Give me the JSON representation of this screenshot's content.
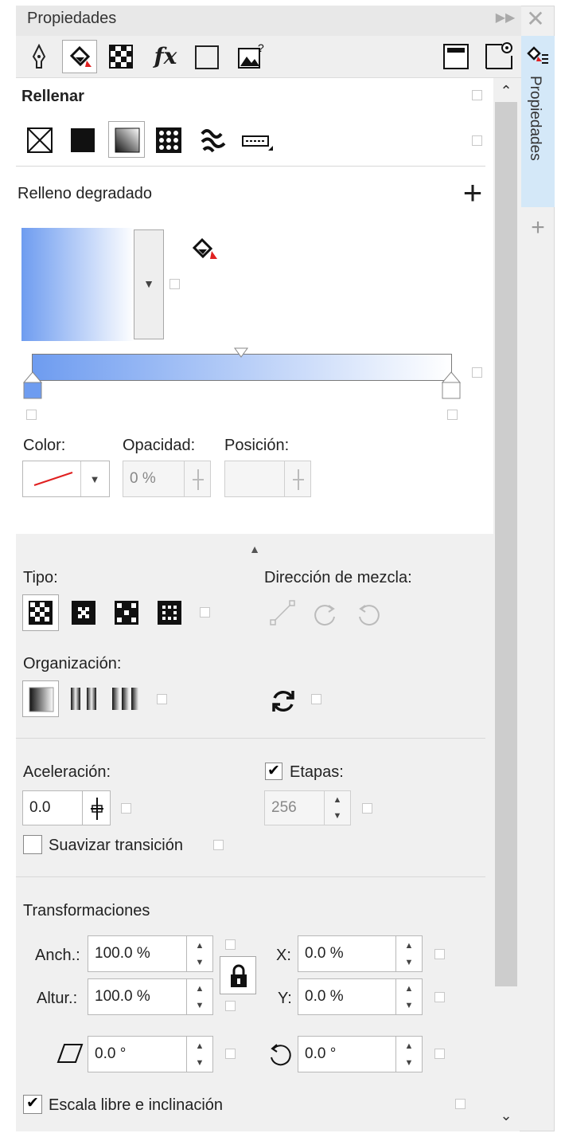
{
  "window": {
    "title": "Propiedades",
    "side_tab_label": "Propiedades"
  },
  "fill": {
    "heading": "Rellenar",
    "section_label": "Relleno degradado",
    "gradient_colors": [
      "#6e9cf0",
      "#ffffff"
    ]
  },
  "node": {
    "color_label": "Color:",
    "opacity_label": "Opacidad:",
    "opacity_value": "0 %",
    "position_label": "Posición:",
    "position_value": ""
  },
  "tipo": {
    "label": "Tipo:"
  },
  "direccion": {
    "label": "Dirección de mezcla:"
  },
  "organizacion": {
    "label": "Organización:"
  },
  "aceleracion": {
    "label": "Aceleración:",
    "value": "0.0"
  },
  "etapas": {
    "label": "Etapas:",
    "value": "256",
    "checked": true
  },
  "suavizar": {
    "label": "Suavizar transición",
    "checked": false
  },
  "transform": {
    "heading": "Transformaciones",
    "width_label": "Anch.:",
    "width_value": "100.0 %",
    "height_label": "Altur.:",
    "height_value": "100.0 %",
    "x_label": "X:",
    "x_value": "0.0 %",
    "y_label": "Y:",
    "y_value": "0.0 %",
    "skew_value": "0.0 °",
    "rotate_value": "0.0 °"
  },
  "escala": {
    "label": "Escala libre e inclinación",
    "checked": true
  },
  "colors": {
    "accent": "#6e9cf0",
    "selected_tab": "#d4e8f8",
    "red": "#e02020"
  }
}
